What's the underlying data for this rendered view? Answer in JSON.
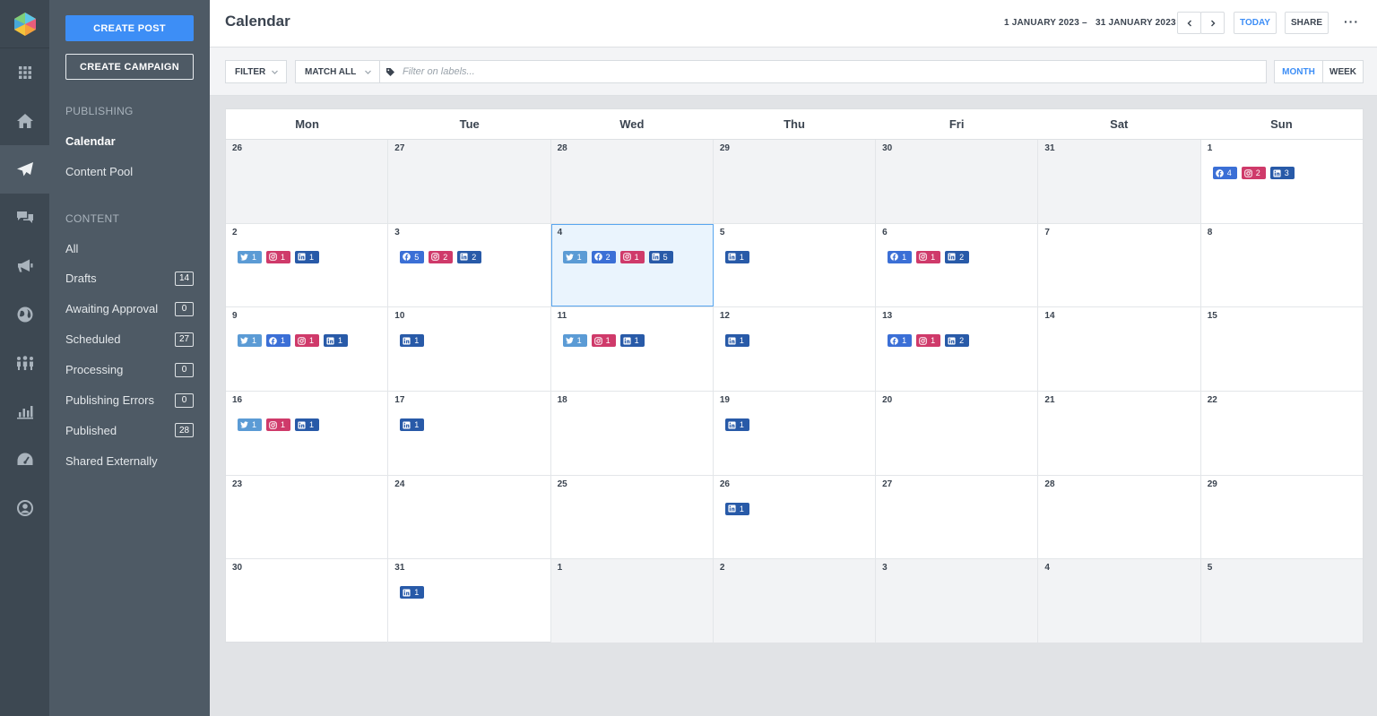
{
  "rail": {
    "items": [
      {
        "icon": "apps-grid-icon",
        "active": false
      },
      {
        "icon": "home-icon",
        "active": false
      },
      {
        "icon": "paper-plane-icon",
        "active": true
      },
      {
        "icon": "chat-bubbles-icon",
        "active": false
      },
      {
        "icon": "megaphone-icon",
        "active": false
      },
      {
        "icon": "globe-icon",
        "active": false
      },
      {
        "icon": "people-icon",
        "active": false
      },
      {
        "icon": "bar-chart-icon",
        "active": false
      },
      {
        "icon": "gauge-icon",
        "active": false
      },
      {
        "icon": "user-circle-icon",
        "active": false
      }
    ]
  },
  "nav": {
    "create_post": "CREATE POST",
    "create_campaign": "CREATE CAMPAIGN",
    "publishing_label": "PUBLISHING",
    "publishing_items": [
      {
        "label": "Calendar",
        "active": true
      },
      {
        "label": "Content Pool",
        "active": false
      }
    ],
    "content_label": "CONTENT",
    "content_items": [
      {
        "label": "All",
        "count": null
      },
      {
        "label": "Drafts",
        "count": "14"
      },
      {
        "label": "Awaiting Approval",
        "count": "0"
      },
      {
        "label": "Scheduled",
        "count": "27"
      },
      {
        "label": "Processing",
        "count": "0"
      },
      {
        "label": "Publishing Errors",
        "count": "0"
      },
      {
        "label": "Published",
        "count": "28"
      },
      {
        "label": "Shared Externally",
        "count": null
      }
    ]
  },
  "header": {
    "title": "Calendar",
    "range_start": "1 JANUARY 2023",
    "range_sep": "–",
    "range_end": "31 JANUARY 2023",
    "today": "TODAY",
    "share": "SHARE",
    "more": "···"
  },
  "filterbar": {
    "filter": "FILTER",
    "match": "MATCH ALL",
    "label_placeholder": "Filter on labels...",
    "month": "MONTH",
    "week": "WEEK"
  },
  "calendar": {
    "weekdays": [
      "Mon",
      "Tue",
      "Wed",
      "Thu",
      "Fri",
      "Sat",
      "Sun"
    ],
    "weeks": [
      [
        {
          "day": "26",
          "out": true,
          "posts": []
        },
        {
          "day": "27",
          "out": true,
          "posts": []
        },
        {
          "day": "28",
          "out": true,
          "posts": []
        },
        {
          "day": "29",
          "out": true,
          "posts": []
        },
        {
          "day": "30",
          "out": true,
          "posts": []
        },
        {
          "day": "31",
          "out": true,
          "posts": []
        },
        {
          "day": "1",
          "out": false,
          "posts": [
            {
              "network": "facebook",
              "count": "4"
            },
            {
              "network": "instagram",
              "count": "2"
            },
            {
              "network": "linkedin",
              "count": "3"
            }
          ]
        }
      ],
      [
        {
          "day": "2",
          "out": false,
          "posts": [
            {
              "network": "twitter",
              "count": "1"
            },
            {
              "network": "instagram",
              "count": "1"
            },
            {
              "network": "linkedin",
              "count": "1"
            }
          ]
        },
        {
          "day": "3",
          "out": false,
          "posts": [
            {
              "network": "facebook",
              "count": "5"
            },
            {
              "network": "instagram",
              "count": "2"
            },
            {
              "network": "linkedin",
              "count": "2"
            }
          ]
        },
        {
          "day": "4",
          "out": false,
          "selected": true,
          "posts": [
            {
              "network": "twitter",
              "count": "1"
            },
            {
              "network": "facebook",
              "count": "2"
            },
            {
              "network": "instagram",
              "count": "1"
            },
            {
              "network": "linkedin",
              "count": "5"
            }
          ]
        },
        {
          "day": "5",
          "out": false,
          "posts": [
            {
              "network": "linkedin",
              "count": "1"
            }
          ]
        },
        {
          "day": "6",
          "out": false,
          "posts": [
            {
              "network": "facebook",
              "count": "1"
            },
            {
              "network": "instagram",
              "count": "1"
            },
            {
              "network": "linkedin",
              "count": "2"
            }
          ]
        },
        {
          "day": "7",
          "out": false,
          "posts": []
        },
        {
          "day": "8",
          "out": false,
          "posts": []
        }
      ],
      [
        {
          "day": "9",
          "out": false,
          "posts": [
            {
              "network": "twitter",
              "count": "1"
            },
            {
              "network": "facebook",
              "count": "1"
            },
            {
              "network": "instagram",
              "count": "1"
            },
            {
              "network": "linkedin",
              "count": "1"
            }
          ]
        },
        {
          "day": "10",
          "out": false,
          "posts": [
            {
              "network": "linkedin",
              "count": "1"
            }
          ]
        },
        {
          "day": "11",
          "out": false,
          "posts": [
            {
              "network": "twitter",
              "count": "1"
            },
            {
              "network": "instagram",
              "count": "1"
            },
            {
              "network": "linkedin",
              "count": "1"
            }
          ]
        },
        {
          "day": "12",
          "out": false,
          "posts": [
            {
              "network": "linkedin",
              "count": "1"
            }
          ]
        },
        {
          "day": "13",
          "out": false,
          "posts": [
            {
              "network": "facebook",
              "count": "1"
            },
            {
              "network": "instagram",
              "count": "1"
            },
            {
              "network": "linkedin",
              "count": "2"
            }
          ]
        },
        {
          "day": "14",
          "out": false,
          "posts": []
        },
        {
          "day": "15",
          "out": false,
          "posts": []
        }
      ],
      [
        {
          "day": "16",
          "out": false,
          "posts": [
            {
              "network": "twitter",
              "count": "1"
            },
            {
              "network": "instagram",
              "count": "1"
            },
            {
              "network": "linkedin",
              "count": "1"
            }
          ]
        },
        {
          "day": "17",
          "out": false,
          "posts": [
            {
              "network": "linkedin",
              "count": "1"
            }
          ]
        },
        {
          "day": "18",
          "out": false,
          "posts": []
        },
        {
          "day": "19",
          "out": false,
          "posts": [
            {
              "network": "linkedin",
              "count": "1"
            }
          ]
        },
        {
          "day": "20",
          "out": false,
          "posts": []
        },
        {
          "day": "21",
          "out": false,
          "posts": []
        },
        {
          "day": "22",
          "out": false,
          "posts": []
        }
      ],
      [
        {
          "day": "23",
          "out": false,
          "posts": []
        },
        {
          "day": "24",
          "out": false,
          "posts": []
        },
        {
          "day": "25",
          "out": false,
          "posts": []
        },
        {
          "day": "26",
          "out": false,
          "posts": [
            {
              "network": "linkedin",
              "count": "1"
            }
          ]
        },
        {
          "day": "27",
          "out": false,
          "posts": []
        },
        {
          "day": "28",
          "out": false,
          "posts": []
        },
        {
          "day": "29",
          "out": false,
          "posts": []
        }
      ],
      [
        {
          "day": "30",
          "out": false,
          "posts": []
        },
        {
          "day": "31",
          "out": false,
          "posts": [
            {
              "network": "linkedin",
              "count": "1"
            }
          ]
        },
        {
          "day": "1",
          "out": true,
          "posts": []
        },
        {
          "day": "2",
          "out": true,
          "posts": []
        },
        {
          "day": "3",
          "out": true,
          "posts": []
        },
        {
          "day": "4",
          "out": true,
          "posts": []
        },
        {
          "day": "5",
          "out": true,
          "posts": []
        }
      ]
    ]
  },
  "colors": {
    "accent": "#3d8ef6",
    "twitter": "#5b9bd5",
    "facebook": "#3b6fd6",
    "instagram": "#cf3a6a",
    "linkedin": "#285aa8"
  }
}
